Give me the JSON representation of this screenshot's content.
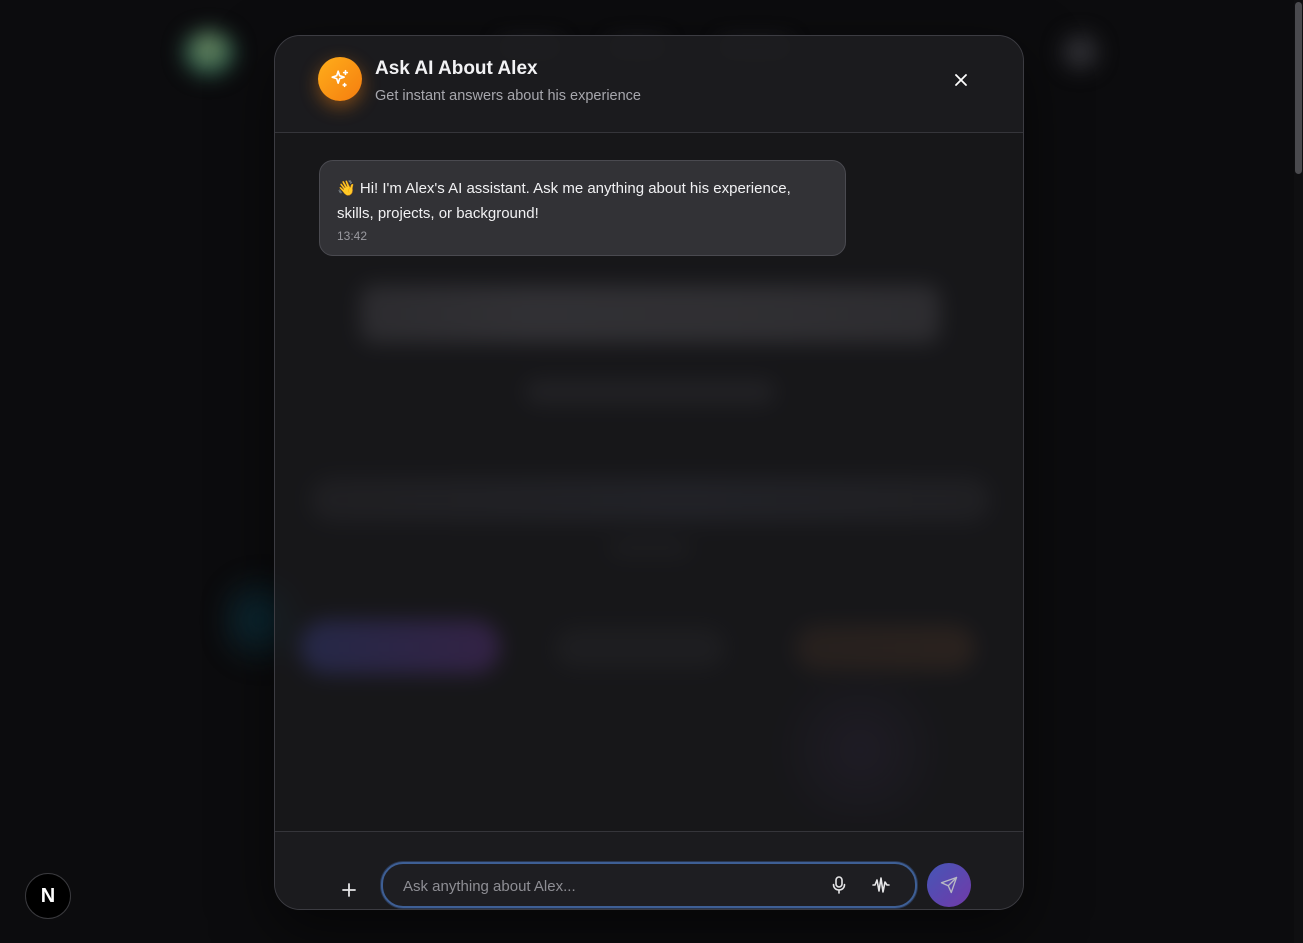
{
  "dialog": {
    "title": "Ask AI About Alex",
    "subtitle": "Get instant answers about his experience",
    "icons": {
      "badge": "sparkles-icon",
      "close": "close-icon"
    }
  },
  "messages": [
    {
      "role": "assistant",
      "emoji": "👋",
      "text": "Hi! I'm Alex's AI assistant. Ask me anything about his experience, skills, projects, or background!",
      "time": "13:42"
    }
  ],
  "composer": {
    "attach_label": "+",
    "placeholder": "Ask anything about Alex...",
    "value": "",
    "icons": {
      "attach": "plus-icon",
      "mic": "microphone-icon",
      "voice": "audio-waveform-icon",
      "send": "send-icon"
    }
  },
  "corner_badge": {
    "label": "N"
  },
  "colors": {
    "accent_orange": "#f7941d",
    "send_gradient_start": "#4a5cc8",
    "send_gradient_end": "#7c3fb8",
    "input_border": "#3e5f95"
  }
}
